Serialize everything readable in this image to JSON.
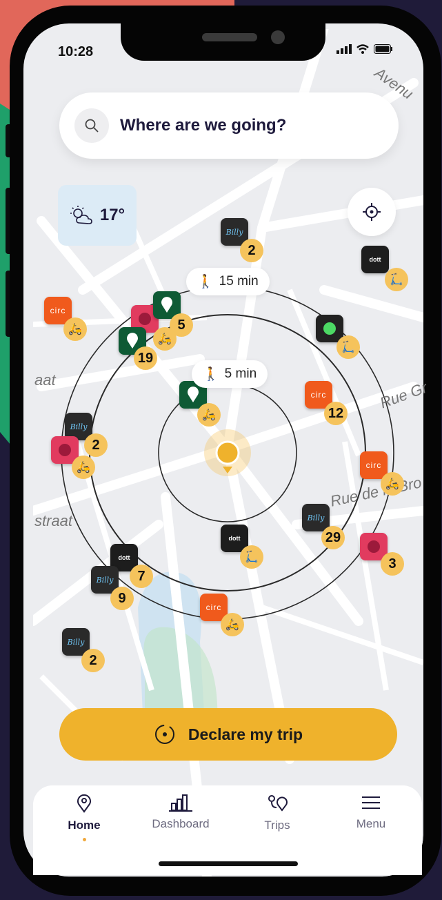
{
  "status": {
    "time": "10:28"
  },
  "search": {
    "placeholder": "Where are we going?"
  },
  "weather": {
    "temperature": "17°"
  },
  "walk_labels": {
    "far": "15 min",
    "near": "5 min"
  },
  "map_labels": {
    "avenue": "Avenu",
    "rue_gr": "Rue Gr",
    "rue_bro": "Rue de la Bro",
    "straat_left": "aat",
    "straat_mid": "straat"
  },
  "markers": {
    "billy_top": "2",
    "circ_left_top": "",
    "cluster_top": "5",
    "green_cluster": "19",
    "billy_left": "2",
    "circ_mid": "12",
    "billy_mid_right": "29",
    "pink_right": "3",
    "dott_left": "7",
    "billy_left_low": "9",
    "billy_bottom": "2"
  },
  "brands": {
    "billy": "Billy",
    "circ": "circ",
    "dott": "dott",
    "lime": "Lime"
  },
  "actions": {
    "declare_trip": "Declare my trip"
  },
  "tabs": [
    {
      "label": "Home",
      "active": true
    },
    {
      "label": "Dashboard",
      "active": false
    },
    {
      "label": "Trips",
      "active": false
    },
    {
      "label": "Menu",
      "active": false
    }
  ],
  "colors": {
    "accent": "#efb22c",
    "badge": "#f5c35c",
    "circ": "#f05a1c",
    "billy": "#2a2a2a",
    "navy": "#1e1a3c"
  }
}
